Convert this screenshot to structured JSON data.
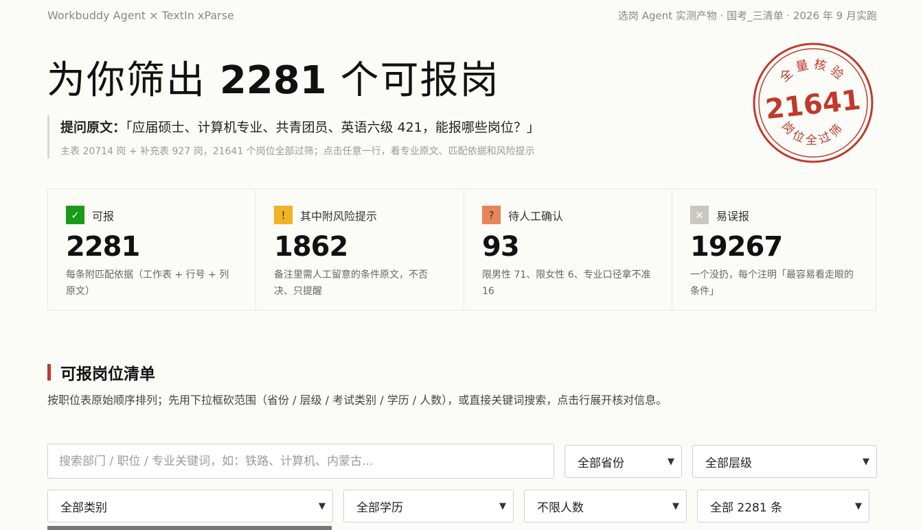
{
  "topbar": {
    "left": "Workbuddy Agent × TextIn xParse",
    "right": "选岗 Agent 实测产物 · 国考_三清单 · 2026 年 9 月实跑"
  },
  "hero": {
    "prefix": "为你筛出",
    "count": "2281",
    "suffix": "个可报岗"
  },
  "quote": {
    "label": "提问原文：",
    "text": "「应届硕士、计算机专业、共青团员、英语六级 421，能报哪些岗位？」",
    "sub": "主表 20714 岗 + 补充表 927 岗，21641 个岗位全部过筛；点击任意一行，看专业原文、匹配依据和风险提示"
  },
  "stamp": {
    "top": "全量核验",
    "number": "21641",
    "bottom": "岗位全过筛",
    "color": "#c0392b"
  },
  "stats": [
    {
      "icon": "✓",
      "icon_name": "check-icon",
      "icon_bg": "#1a9c1a",
      "label": "可报",
      "value": "2281",
      "desc": "每条附匹配依据（工作表 + 行号 + 列原文）"
    },
    {
      "icon": "!",
      "icon_name": "warning-icon",
      "icon_bg": "#f0b323",
      "label": "其中附风险提示",
      "value": "1862",
      "desc": "备注里需人工留意的条件原文，不否决、只提醒"
    },
    {
      "icon": "?",
      "icon_name": "question-icon",
      "icon_bg": "#e8845a",
      "label": "待人工确认",
      "value": "93",
      "desc": "限男性 71、限女性 6、专业口径拿不准 16"
    },
    {
      "icon": "✕",
      "icon_name": "close-icon",
      "icon_bg": "#c8c8c0",
      "label": "易误报",
      "value": "19267",
      "desc": "一个没扔，每个注明「最容易看走眼的条件」"
    }
  ],
  "section": {
    "title": "可报岗位清单",
    "desc": "按职位表原始顺序排列；先用下拉框砍范围（省份 / 层级 / 考试类别 / 学历 / 人数），或直接关键词搜索，点击行展开核对信息。"
  },
  "filters": {
    "search_placeholder": "搜索部门 / 职位 / 专业关键词，如：铁路、计算机、内蒙古...",
    "province": "全部省份",
    "level": "全部层级",
    "category": "全部类别",
    "education": "全部学历",
    "headcount": "不限人数",
    "total": "全部 2281 条"
  }
}
